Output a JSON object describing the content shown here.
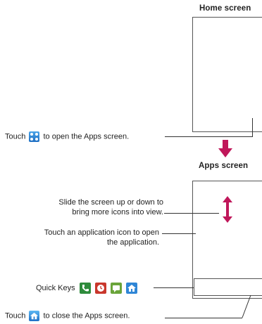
{
  "home_section": {
    "title": "Home screen",
    "callout": {
      "before": "Touch",
      "icon": "apps-grid-icon",
      "after": "to open the Apps screen."
    }
  },
  "apps_section": {
    "title": "Apps screen",
    "callout_slide": [
      "Slide the screen up or down to",
      "bring more icons into view."
    ],
    "callout_touch": [
      "Touch an application icon to open",
      "the application."
    ],
    "quick_keys": {
      "label": "Quick Keys",
      "icons": [
        "phone-icon",
        "clock-icon",
        "messaging-icon",
        "home-icon"
      ]
    },
    "callout_close": {
      "before": "Touch",
      "icon": "home-icon",
      "after": "to close the Apps screen."
    }
  },
  "colors": {
    "arrow": "#c0175a",
    "callout_line": "#333333",
    "apps_icon": "#2f86d6"
  }
}
